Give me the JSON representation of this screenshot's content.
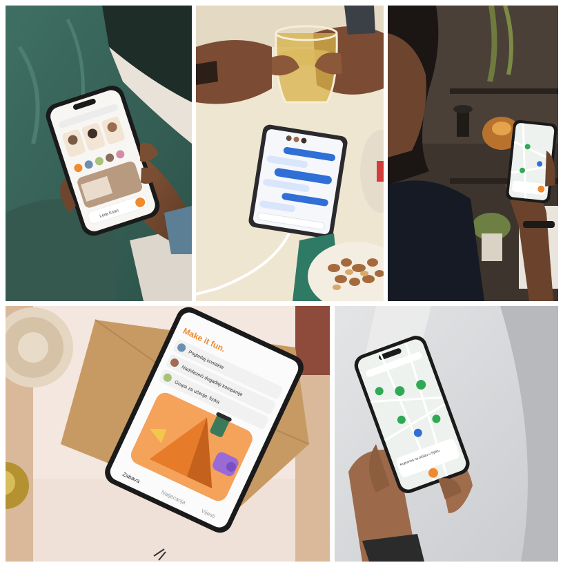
{
  "colors": {
    "accent_orange": "#f08a2e",
    "chat_blue": "#2f6fd6",
    "map_green": "#2eaa55",
    "map_bg": "#eef2ee",
    "kraft_paper": "#c89a63",
    "tea": "#d7b24a"
  },
  "tile1": {
    "app_name": "Leila Kiran"
  },
  "tile4": {
    "tagline": "Make it fun.",
    "items": [
      {
        "label": "Pogledaj kontakte"
      },
      {
        "label": "Nadolazeći događaji kompanije"
      },
      {
        "label": "Grupa za učenje: fizika"
      }
    ],
    "tabs": [
      "Zabava",
      "Natjecanja",
      "Vijesti"
    ]
  },
  "tile5": {
    "card_label": "Kupovina na tržištu u Splitu"
  }
}
